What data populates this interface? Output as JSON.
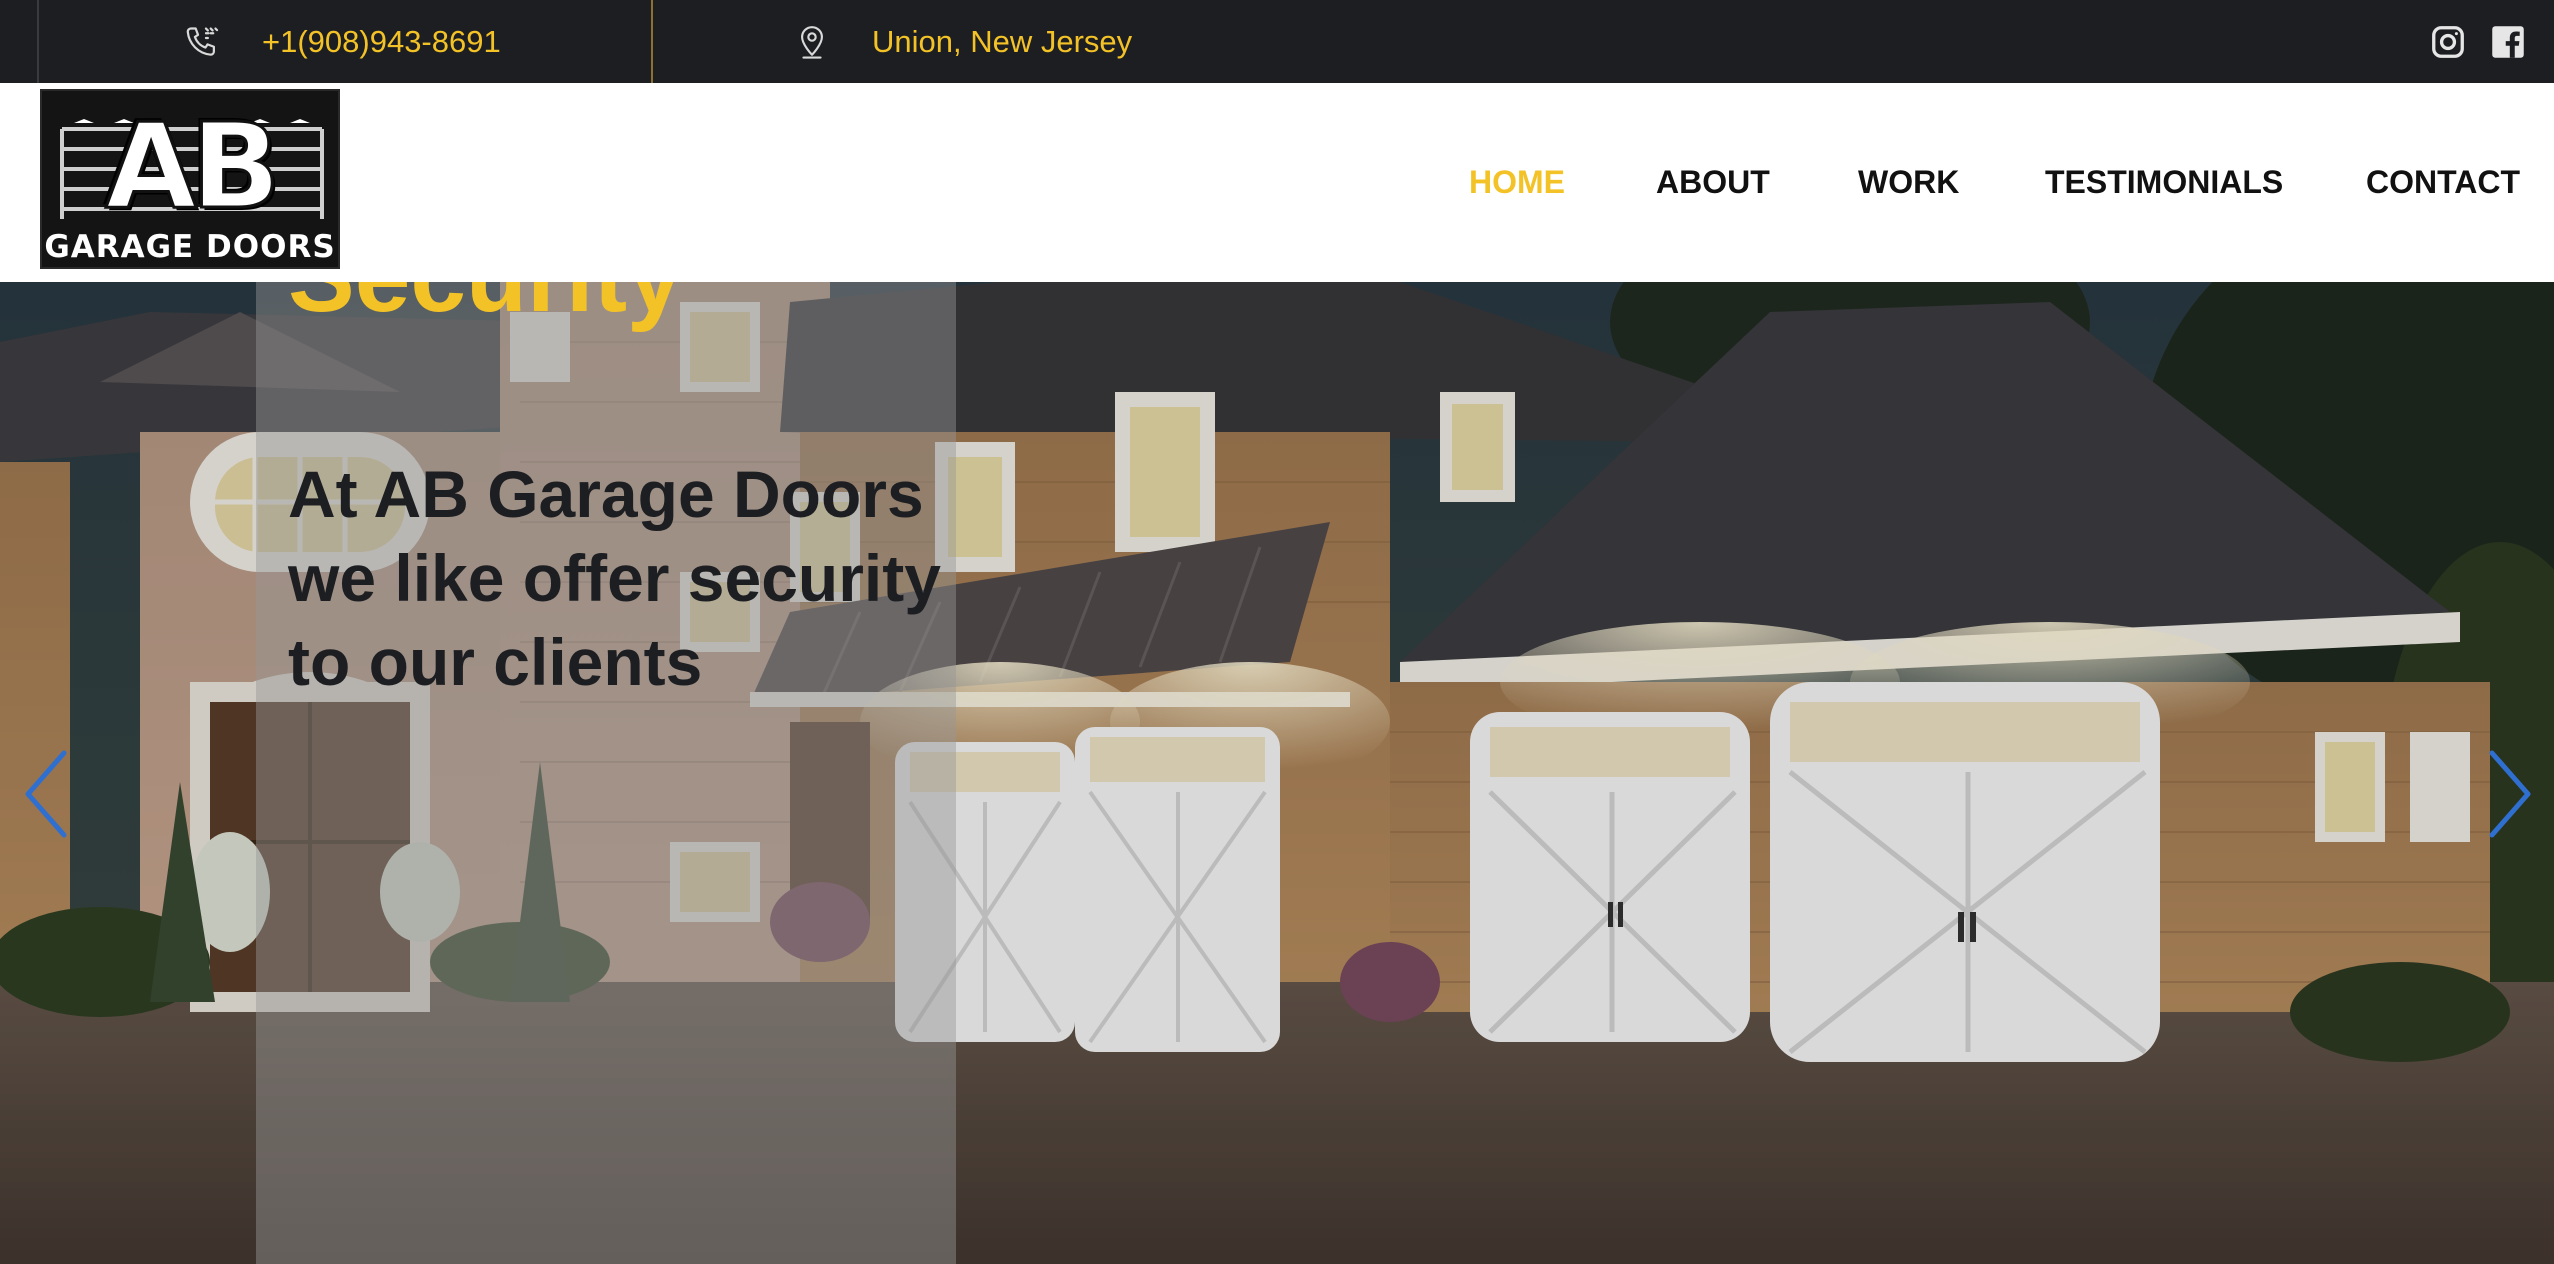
{
  "topbar": {
    "phone": "+1(908)943-8691",
    "location": "Union, New Jersey",
    "phone_icon": "phone-icon",
    "location_icon": "map-pin-icon",
    "social": [
      "instagram-icon",
      "facebook-icon"
    ]
  },
  "logo": {
    "main": "AB",
    "sub": "GARAGE DOORS"
  },
  "nav": {
    "items": [
      {
        "label": "HOME",
        "active": true
      },
      {
        "label": "ABOUT",
        "active": false
      },
      {
        "label": "WORK",
        "active": false
      },
      {
        "label": "TESTIMONIALS",
        "active": false
      },
      {
        "label": "CONTACT",
        "active": false
      }
    ]
  },
  "hero": {
    "overflow_title": "Security",
    "headline": "At AB Garage Doors we like offer security to our clients",
    "prev_icon": "chevron-left-icon",
    "next_icon": "chevron-right-icon"
  },
  "colors": {
    "accent": "#f3c227",
    "topbar_bg": "#1c1e22",
    "header_bg": "#ffffff",
    "text_dark": "#1c1e22",
    "arrow_blue": "#2f6fd0"
  }
}
